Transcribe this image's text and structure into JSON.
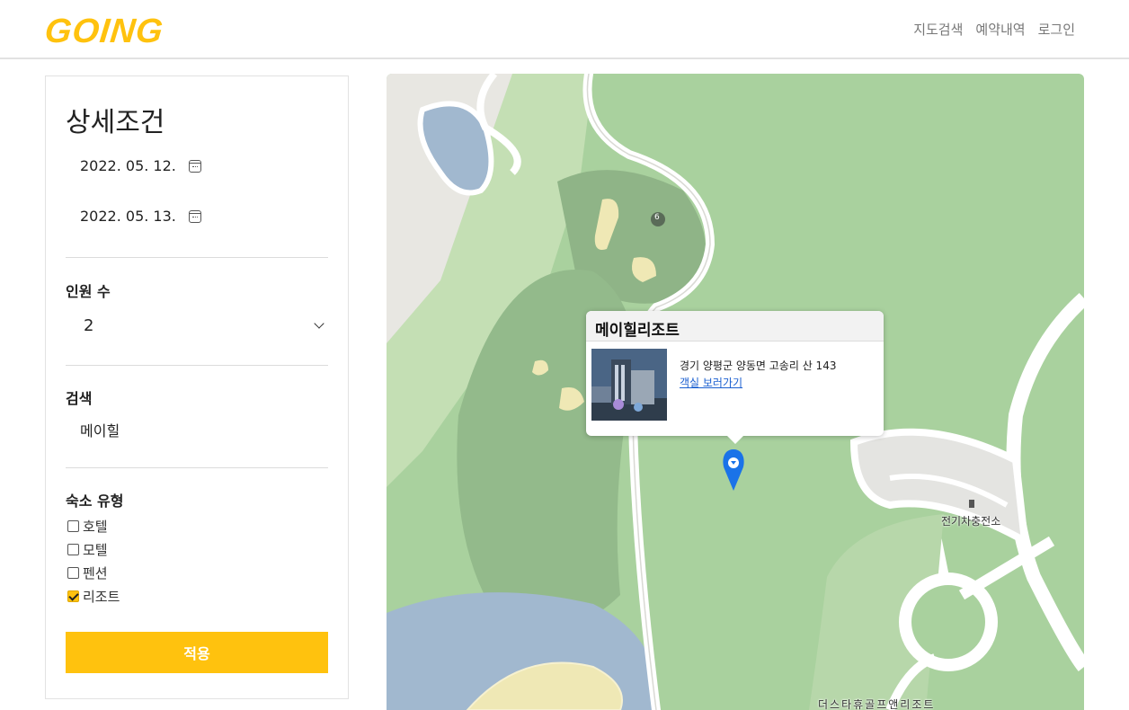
{
  "header": {
    "logo": "GOING",
    "nav": [
      "지도검색",
      "예약내역",
      "로그인"
    ]
  },
  "filters": {
    "title": "상세조건",
    "check_in": "2022. 05. 12.",
    "check_out": "2022. 05. 13.",
    "guests_label": "인원 수",
    "guests_value": "2",
    "search_label": "검색",
    "search_value": "메이힐",
    "type_label": "숙소 유형",
    "types": [
      {
        "label": "호텔",
        "checked": false
      },
      {
        "label": "모텔",
        "checked": false
      },
      {
        "label": "펜션",
        "checked": false
      },
      {
        "label": "리조트",
        "checked": true
      }
    ],
    "apply_label": "적용"
  },
  "map": {
    "popup": {
      "name": "메이힐리조트",
      "address": "경기 양평군 양동면 고송리 산 143",
      "link": "객실 보러가기"
    },
    "labels": {
      "hole": "6",
      "ev_station": "전기차충전소",
      "golf": "더스타휴골프앤리조트"
    }
  },
  "colors": {
    "accent": "#ffc20e",
    "marker": "#1a73e8",
    "link": "#1a5fd0"
  }
}
